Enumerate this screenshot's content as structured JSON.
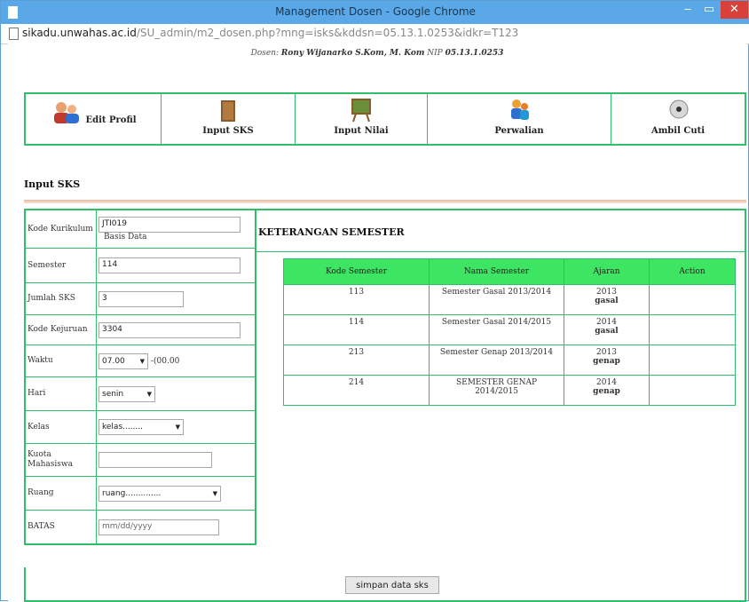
{
  "window": {
    "title": "Management Dosen - Google Chrome",
    "url_domain": "sikadu.unwahas.ac.id",
    "url_path": "/SU_admin/m2_dosen.php?mng=isks&kddsn=05.13.1.0253&idkr=T123"
  },
  "header": {
    "dosen_label": "Dosen:",
    "dosen_name": "Rony Wijanarko S.Kom, M. Kom",
    "nip_label": "NIP",
    "nip_value": "05.13.1.0253"
  },
  "nav": [
    {
      "label": "Edit Profil",
      "icon": "users-icon"
    },
    {
      "label": "Input SKS",
      "icon": "book-icon"
    },
    {
      "label": "Input Nilai",
      "icon": "chalkboard-icon"
    },
    {
      "label": "Perwalian",
      "icon": "people-icon"
    },
    {
      "label": "Ambil Cuti",
      "icon": "disc-icon"
    }
  ],
  "section_title": "Input SKS",
  "form": {
    "kode_kurikulum_label": "Kode Kurikulum",
    "kode_kurikulum_value": "JTI019",
    "kode_kurikulum_desc": "Basis Data",
    "semester_label": "Semester",
    "semester_value": "114",
    "jumlah_sks_label": "Jumlah SKS",
    "jumlah_sks_value": "3",
    "kode_kejuruan_label": "Kode Kejuruan",
    "kode_kejuruan_value": "3304",
    "waktu_label": "Waktu",
    "waktu_value": "07.00",
    "waktu_suffix": "-(00.00",
    "hari_label": "Hari",
    "hari_value": "senin",
    "kelas_label": "Kelas",
    "kelas_value": "kelas........",
    "kuota_label": "Kuota Mahasiswa",
    "kuota_value": "",
    "ruang_label": "Ruang",
    "ruang_value": "ruang..............",
    "batas_label": "BATAS",
    "batas_placeholder": "mm/dd/yyyy"
  },
  "keterangan": {
    "title": "KETERANGAN SEMESTER",
    "headers": [
      "Kode Semester",
      "Nama Semester",
      "Ajaran",
      "Action"
    ],
    "rows": [
      {
        "kode": "113",
        "nama": "Semester Gasal 2013/2014",
        "tahun": "2013",
        "tipe": "gasal",
        "action": ""
      },
      {
        "kode": "114",
        "nama": "Semester Gasal 2014/2015",
        "tahun": "2014",
        "tipe": "gasal",
        "action": ""
      },
      {
        "kode": "213",
        "nama": "Semester Genap 2013/2014",
        "tahun": "2013",
        "tipe": "genap",
        "action": ""
      },
      {
        "kode": "214",
        "nama": "SEMESTER GENAP 2014/2015",
        "tahun": "2014",
        "tipe": "genap",
        "action": ""
      }
    ]
  },
  "submit_label": "simpan data sks"
}
